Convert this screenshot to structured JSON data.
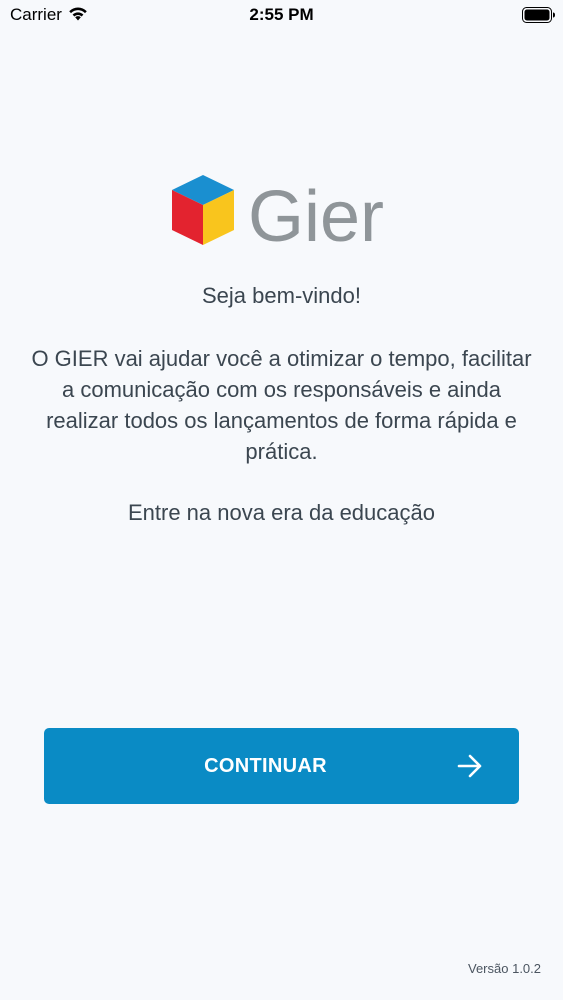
{
  "status_bar": {
    "carrier": "Carrier",
    "time": "2:55 PM",
    "icons": [
      "wifi-icon",
      "battery-icon"
    ]
  },
  "logo": {
    "wordmark": "Gier",
    "colors": {
      "top": "#1a8fd0",
      "left": "#e3232f",
      "right": "#f9c51d",
      "wordmark": "#8f9599"
    }
  },
  "welcome": {
    "title": "Seja bem-vindo!",
    "description": "O GIER vai ajudar você a otimizar o tempo, facilitar a comunicação com os responsáveis e ainda realizar todos os lançamentos de forma rápida e prática.",
    "tagline": "Entre na nova era da educação"
  },
  "continue_button": {
    "label": "CONTINUAR",
    "icon": "arrow-right-icon",
    "color": "#0a8bc5"
  },
  "footer": {
    "version": "Versão 1.0.2"
  }
}
